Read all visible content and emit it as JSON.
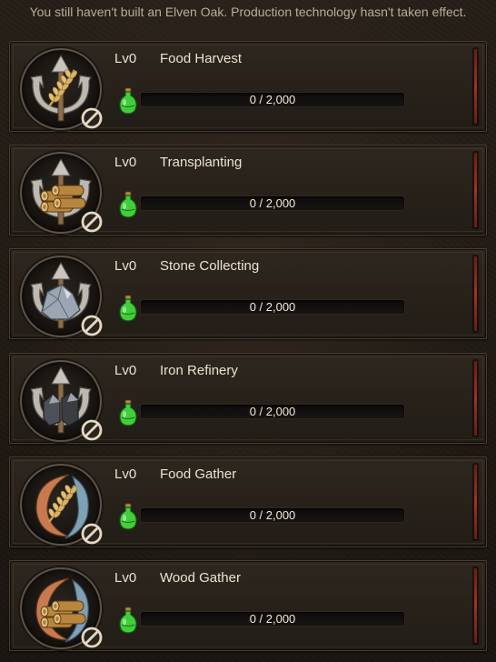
{
  "notice": "You still haven't built an Elven Oak. Production technology hasn't taken effect.",
  "colors": {
    "background": "#1d1813",
    "card": "#2a231c",
    "progress_track": "#111010",
    "status_bar": "#a2321e",
    "potion": "#3fcf3a"
  },
  "technologies": [
    {
      "level": "Lv0",
      "name": "Food Harvest",
      "progress_text": "0 / 2,000",
      "progress": 0,
      "icon": "wheat-trident-icon"
    },
    {
      "level": "Lv0",
      "name": "Transplanting",
      "progress_text": "0 / 2,000",
      "progress": 0,
      "icon": "logs-trident-icon"
    },
    {
      "level": "Lv0",
      "name": "Stone Collecting",
      "progress_text": "0 / 2,000",
      "progress": 0,
      "icon": "stone-trident-icon"
    },
    {
      "level": "Lv0",
      "name": "Iron Refinery",
      "progress_text": "0 / 2,000",
      "progress": 0,
      "icon": "iron-trident-icon"
    },
    {
      "level": "Lv0",
      "name": "Food Gather",
      "progress_text": "0 / 2,000",
      "progress": 0,
      "icon": "wheat-gather-icon"
    },
    {
      "level": "Lv0",
      "name": "Wood Gather",
      "progress_text": "0 / 2,000",
      "progress": 0,
      "icon": "logs-gather-icon"
    }
  ]
}
